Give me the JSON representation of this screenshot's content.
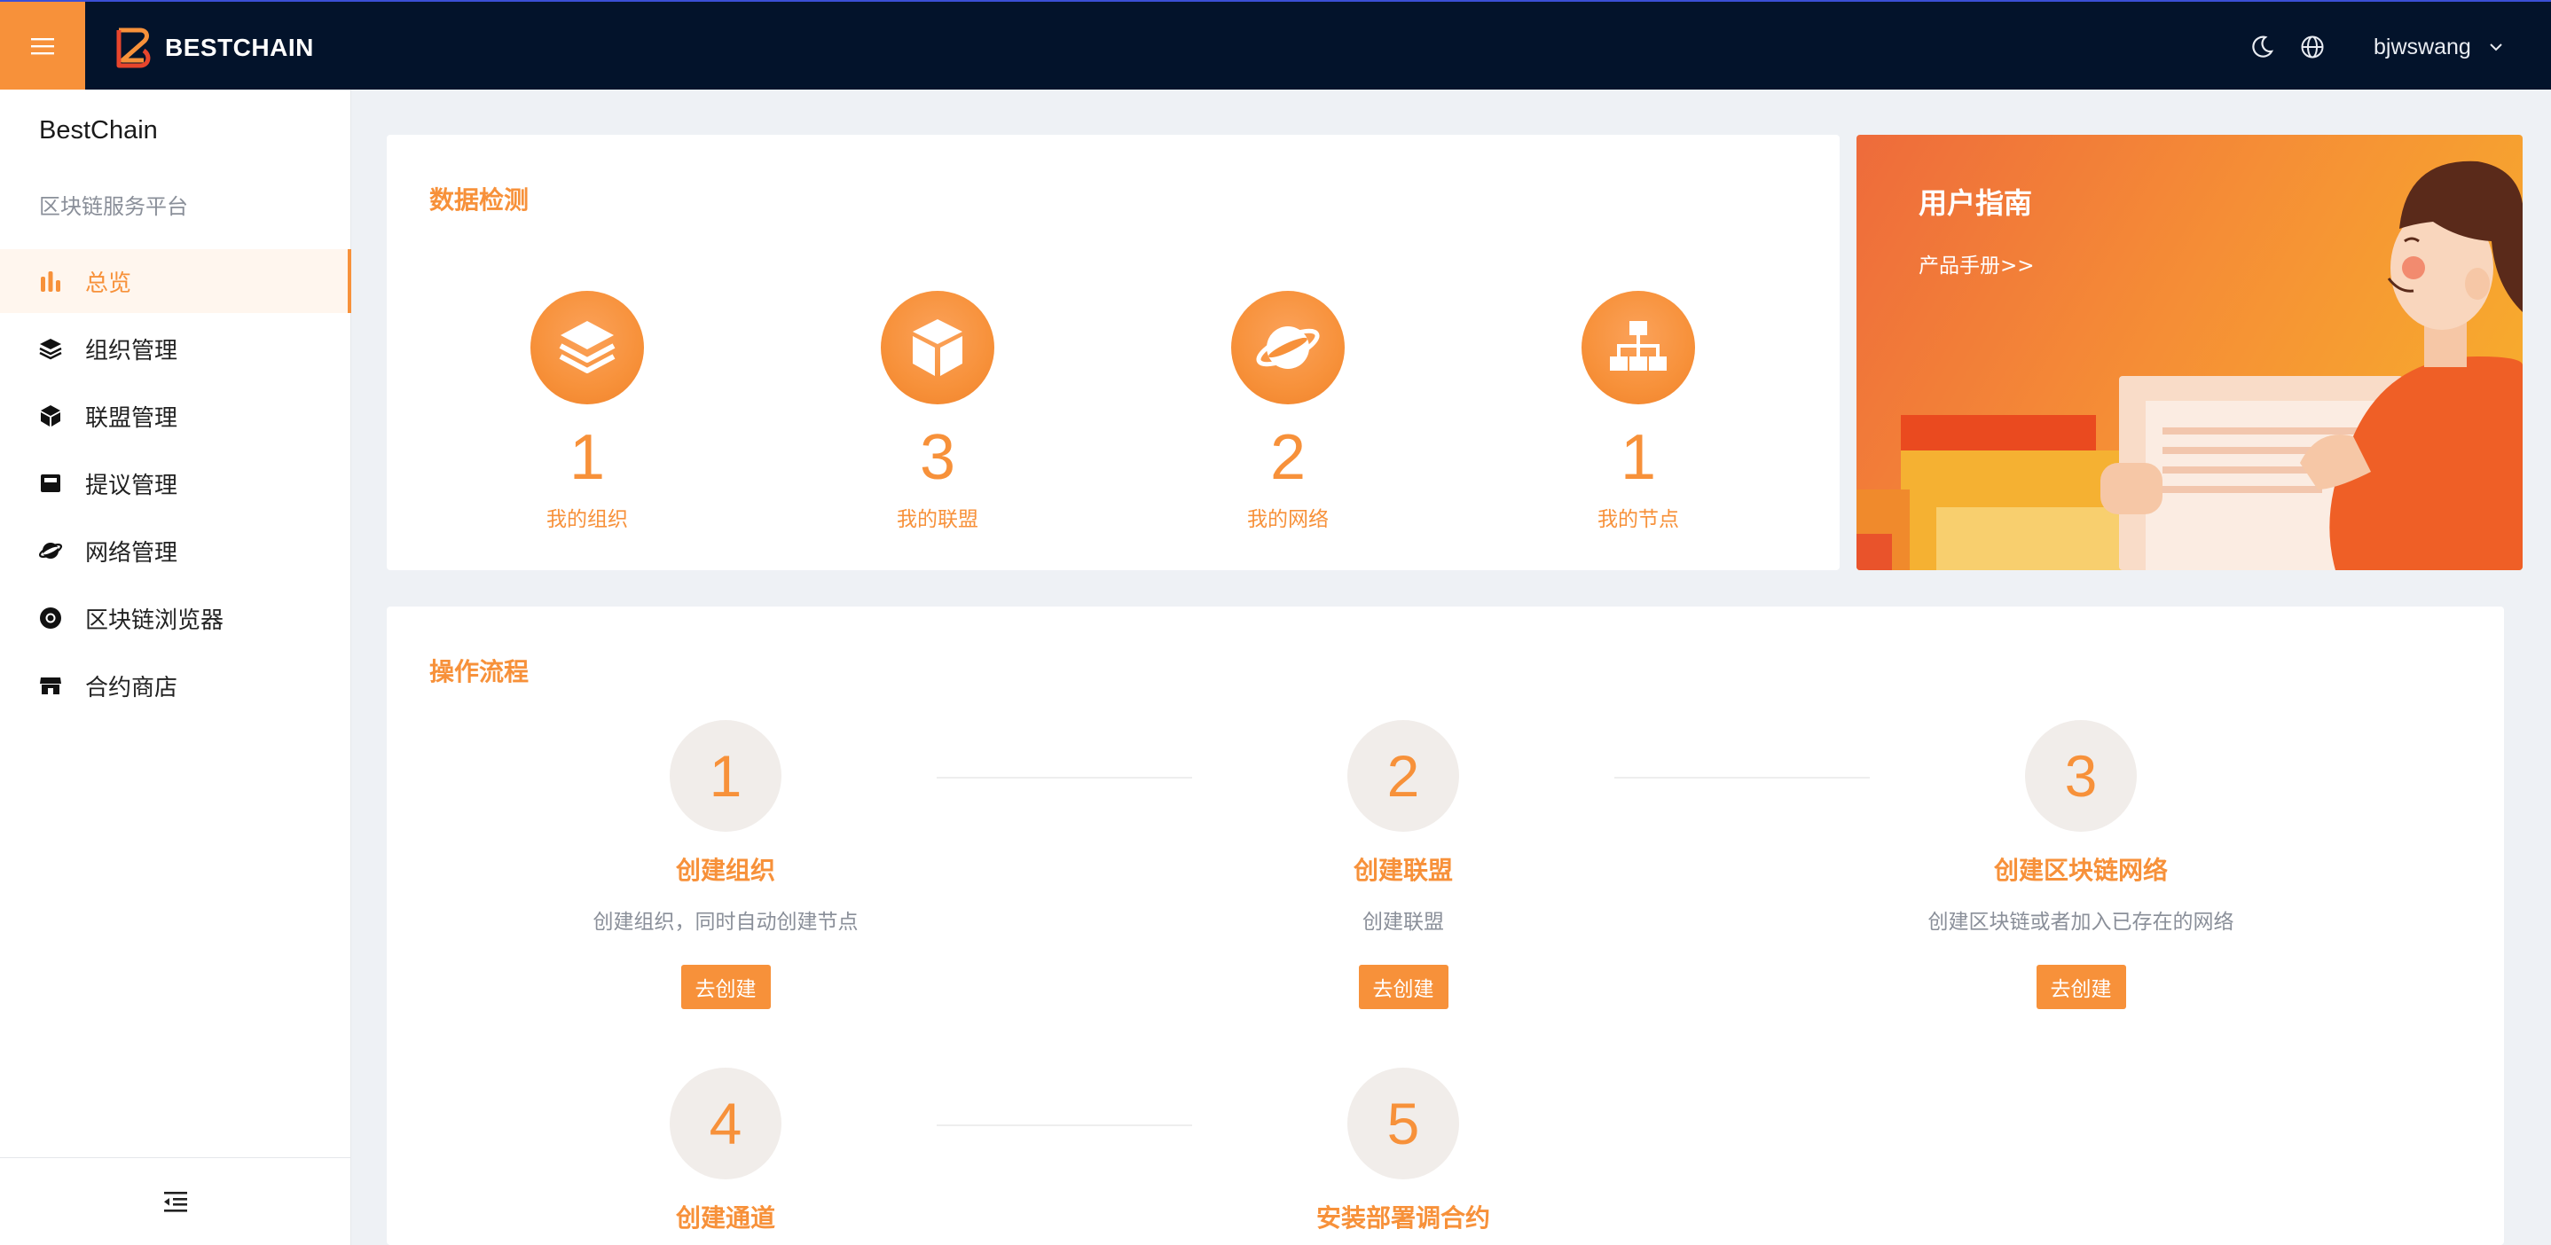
{
  "app": {
    "logo_text": "BESTCHAIN",
    "user_name": "bjwswang",
    "accent_color": "#f7913a",
    "topbar_color": "#03132b"
  },
  "sidebar": {
    "brand_title": "BestChain",
    "brand_subtitle": "区块链服务平台",
    "items": [
      {
        "label": "总览",
        "icon": "bar-chart-icon",
        "active": true
      },
      {
        "label": "组织管理",
        "icon": "layers-icon",
        "active": false
      },
      {
        "label": "联盟管理",
        "icon": "cube-icon",
        "active": false
      },
      {
        "label": "提议管理",
        "icon": "inbox-icon",
        "active": false
      },
      {
        "label": "网络管理",
        "icon": "planet-icon",
        "active": false
      },
      {
        "label": "区块链浏览器",
        "icon": "chrome-icon",
        "active": false
      },
      {
        "label": "合约商店",
        "icon": "shop-icon",
        "active": false
      }
    ]
  },
  "stats_card": {
    "title": "数据检测",
    "stats": [
      {
        "value": "1",
        "label": "我的组织",
        "icon": "layers-icon"
      },
      {
        "value": "3",
        "label": "我的联盟",
        "icon": "cube-icon"
      },
      {
        "value": "2",
        "label": "我的网络",
        "icon": "planet-icon"
      },
      {
        "value": "1",
        "label": "我的节点",
        "icon": "org-tree-icon"
      }
    ]
  },
  "guide": {
    "title": "用户指南",
    "link": "产品手册>>"
  },
  "process_card": {
    "title": "操作流程",
    "steps": [
      {
        "number": "1",
        "title": "创建组织",
        "desc": "创建组织，同时自动创建节点",
        "button": "去创建"
      },
      {
        "number": "2",
        "title": "创建联盟",
        "desc": "创建联盟",
        "button": "去创建"
      },
      {
        "number": "3",
        "title": "创建区块链网络",
        "desc": "创建区块链或者加入已存在的网络",
        "button": "去创建"
      },
      {
        "number": "4",
        "title": "创建通道"
      },
      {
        "number": "5",
        "title": "安装部署调合约"
      }
    ]
  }
}
